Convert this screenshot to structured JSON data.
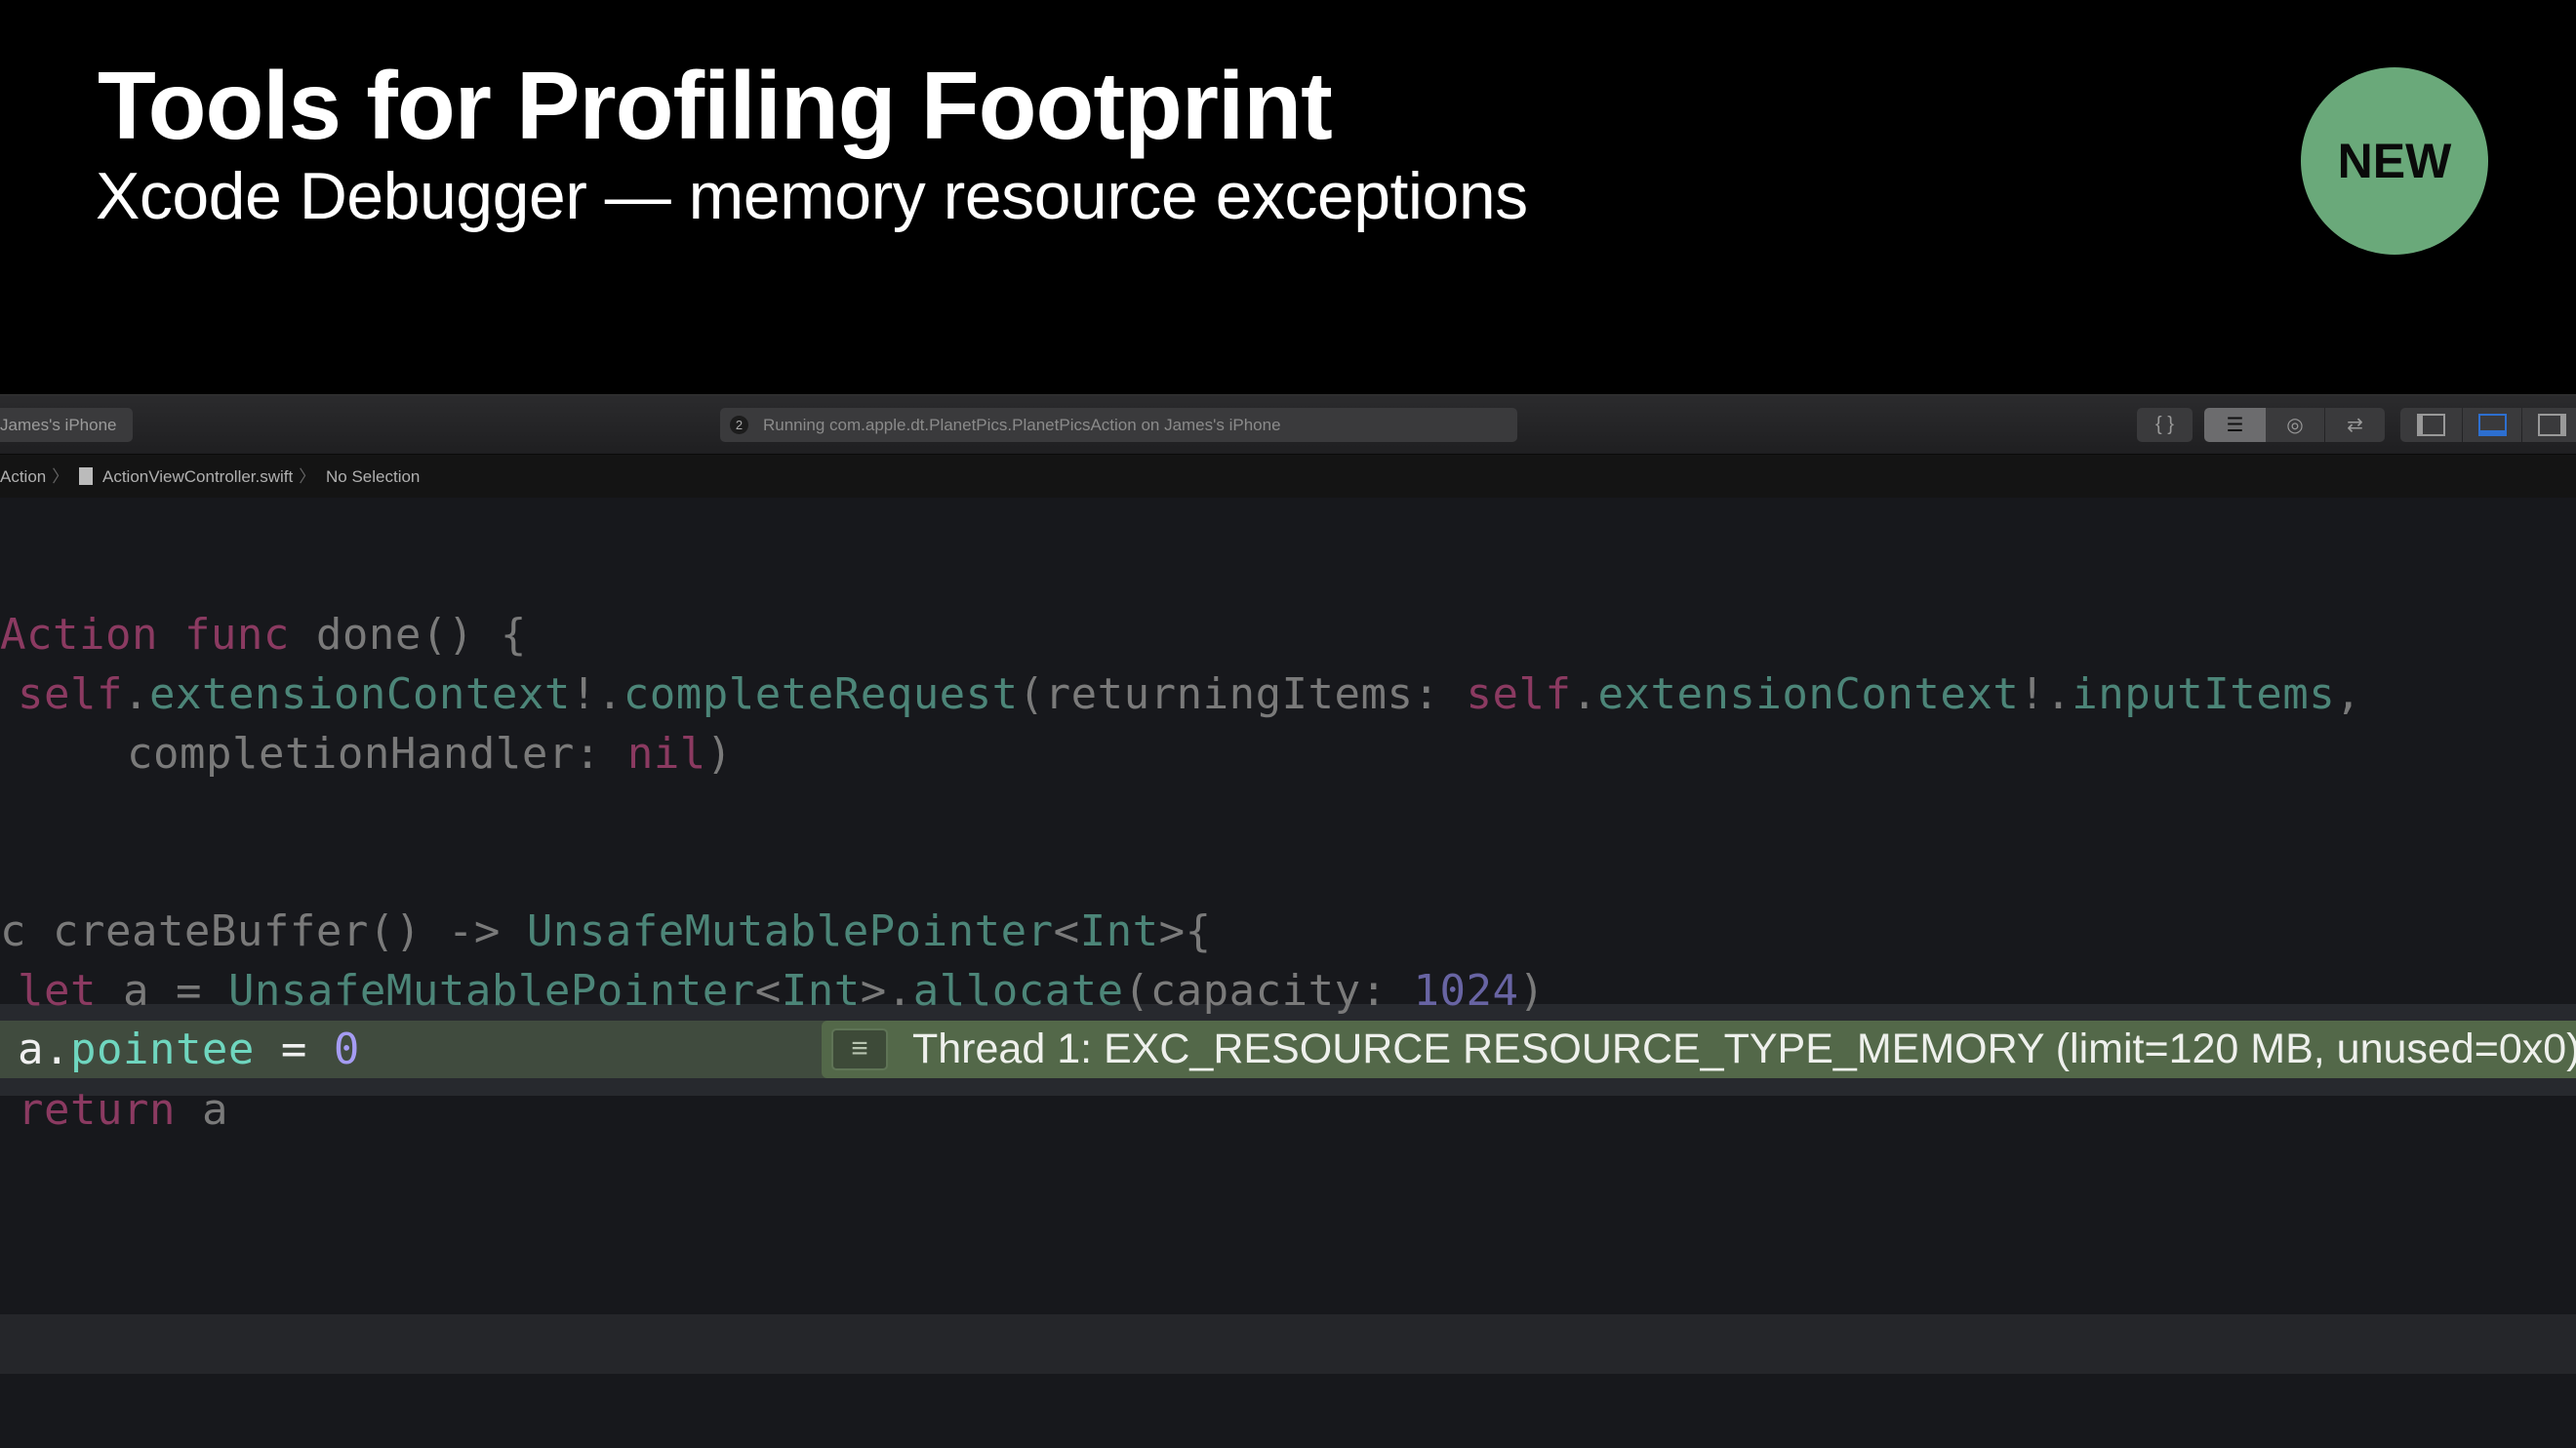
{
  "slide": {
    "title": "Tools for Profiling Footprint",
    "subtitle": "Xcode Debugger — memory resource exceptions",
    "badge": "NEW",
    "badge_color": "#6aa97a"
  },
  "toolbar": {
    "scheme": "James's iPhone",
    "activity_count": "2",
    "activity": "Running com.apple.dt.PlanetPics.PlanetPicsAction on James's iPhone",
    "buttons": [
      "braces-icon",
      "standard-editor-icon",
      "assistant-editor-icon",
      "version-editor-icon",
      "navigator-toggle-icon",
      "debug-area-toggle-icon",
      "inspector-toggle-icon"
    ]
  },
  "breadcrumb": {
    "items": [
      "Action",
      "ActionViewController.swift",
      "No Selection"
    ]
  },
  "code": {
    "l1": {
      "a": "Action",
      "b": " func",
      "c": " done() {"
    },
    "l2": {
      "a": "self",
      "b": ".",
      "c": "extensionContext",
      "d": "!.",
      "e": "completeRequest",
      "f": "(returningItems: ",
      "g": "self",
      "h": ".",
      "i": "extensionContext",
      "j": "!.",
      "k": "inputItems",
      ",": ","
    },
    "l3": {
      "a": "completionHandler: ",
      "b": "nil",
      "c": ")"
    },
    "l4": {
      "a": "c createBuffer() -> ",
      "b": "UnsafeMutablePointer",
      "c": "<",
      "d": "Int",
      "e": ">{"
    },
    "l5": {
      "a": "let",
      "b": " a = ",
      "c": "UnsafeMutablePointer",
      "d": "<",
      "e": "Int",
      "f": ">.",
      "g": "allocate",
      "h": "(capacity: ",
      "i": "1024",
      "j": ")"
    },
    "l6": {
      "a": "a.",
      "b": "pointee",
      "c": " = ",
      "d": "0"
    },
    "l7": {
      "a": "return",
      "b": " a"
    }
  },
  "exception": {
    "icon": "list-icon",
    "message": "Thread 1: EXC_RESOURCE RESOURCE_TYPE_MEMORY (limit=120 MB, unused=0x0)",
    "color": "#536849"
  }
}
